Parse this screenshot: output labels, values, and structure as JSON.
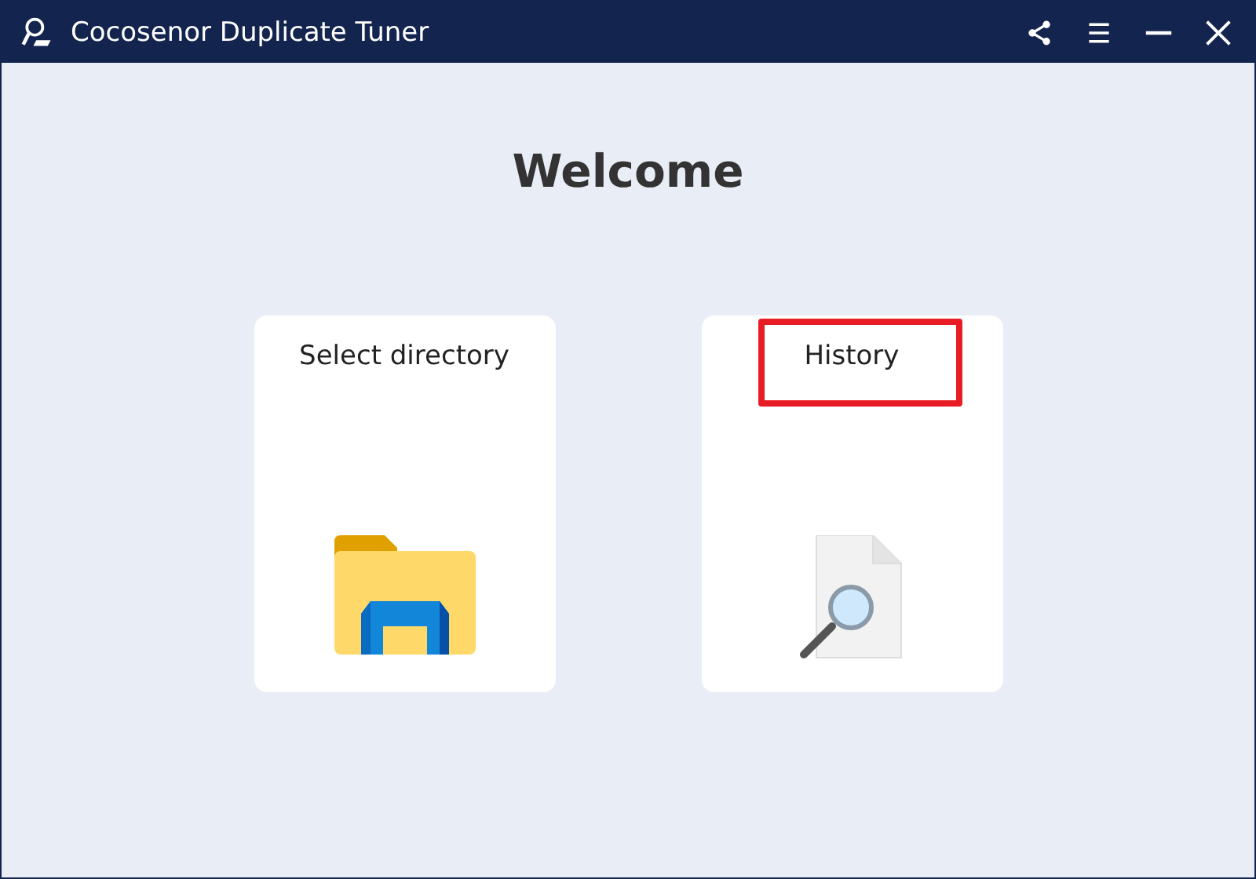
{
  "window": {
    "title": "Cocosenor Duplicate Tuner"
  },
  "heading": "Welcome",
  "cards": [
    {
      "label": "Select directory",
      "kind": "folder",
      "highlighted": false
    },
    {
      "label": "History",
      "kind": "document-search",
      "highlighted": true
    }
  ]
}
